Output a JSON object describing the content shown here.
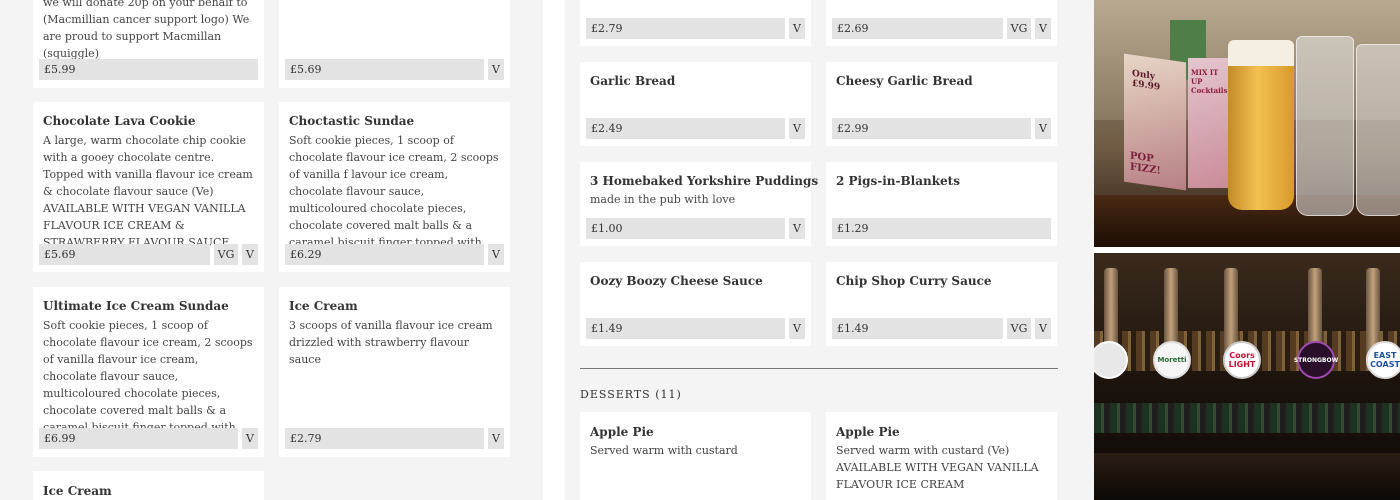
{
  "left_cards": [
    {
      "title": "",
      "desc": "we will donate 20p on your behalf to (Macmillian cancer support logo) We are proud to support Macmillan (squiggle)",
      "price": "£5.99",
      "tags": []
    },
    {
      "title": "",
      "desc": "",
      "price": "£5.69",
      "tags": [
        "V"
      ]
    },
    {
      "title": "Chocolate Lava Cookie",
      "desc": "A large, warm chocolate chip cookie with a gooey chocolate centre. Topped with vanilla flavour ice cream & chocolate flavour sauce (Ve) AVAILABLE WITH VEGAN VANILLA FLAVOUR ICE CREAM & STRAWBERRY FLAVOUR SAUCE",
      "price": "£5.69",
      "tags": [
        "VG",
        "V"
      ]
    },
    {
      "title": "Choctastic Sundae",
      "desc": "Soft cookie pieces, 1 scoop of chocolate flavour ice cream, 2 scoops of vanilla f lavour ice cream, chocolate flavour sauce, multicoloured chocolate pieces, chocolate covered malt balls & a caramel biscuit finger topped with cream",
      "price": "£6.29",
      "tags": [
        "V"
      ]
    },
    {
      "title": "Ultimate Ice Cream Sundae",
      "desc": "Soft cookie pieces, 1 scoop of chocolate flavour ice cream, 2 scoops of vanilla flavour ice cream, chocolate flavour sauce, multicoloured chocolate pieces, chocolate covered malt balls & a caramel biscuit finger topped with cream",
      "price": "£6.99",
      "tags": [
        "V"
      ]
    },
    {
      "title": "Ice Cream",
      "desc": "3 scoops of vanilla flavour ice cream drizzled with strawberry flavour sauce",
      "price": "£2.79",
      "tags": [
        "V"
      ]
    },
    {
      "title": "Ice Cream",
      "desc": "",
      "price": "",
      "tags": []
    }
  ],
  "mid_cards": [
    {
      "title": "",
      "desc": "",
      "price": "£2.79",
      "tags": [
        "V"
      ]
    },
    {
      "title": "",
      "desc": "",
      "price": "£2.69",
      "tags": [
        "VG",
        "V"
      ]
    },
    {
      "title": "Garlic Bread",
      "desc": "",
      "price": "£2.49",
      "tags": [
        "V"
      ]
    },
    {
      "title": "Cheesy Garlic Bread",
      "desc": "",
      "price": "£2.99",
      "tags": [
        "V"
      ]
    },
    {
      "title": "3 Homebaked Yorkshire Puddings",
      "desc": "made in the pub with love",
      "price": "£1.00",
      "tags": [
        "V"
      ]
    },
    {
      "title": "2 Pigs-in-Blankets",
      "desc": "",
      "price": "£1.29",
      "tags": []
    },
    {
      "title": "Oozy Boozy Cheese Sauce",
      "desc": "",
      "price": "£1.49",
      "tags": [
        "V"
      ]
    },
    {
      "title": "Chip Shop Curry Sauce",
      "desc": "",
      "price": "£1.49",
      "tags": [
        "VG",
        "V"
      ]
    }
  ],
  "desserts_heading": "DESSERTS (11)",
  "dessert_cards": [
    {
      "title": "Apple Pie",
      "desc": "Served warm with custard"
    },
    {
      "title": "Apple Pie",
      "desc": "Served warm with custard (Ve) AVAILABLE WITH VEGAN VANILLA FLAVOUR ICE CREAM"
    }
  ],
  "photos": {
    "top_alt": "beer glasses on table",
    "bottom_alt": "bar taps",
    "poster_text": "POP FIZZ!",
    "poster_price": "Only £9.99",
    "poster2_text": "MIX IT UP Cocktails",
    "tap_badges": [
      "",
      "Moretti",
      "Coors LIGHT",
      "STRONGBOW",
      "EAST COAST"
    ],
    "colors": {
      "accent": "#e3e3e3",
      "card": "#ffffff",
      "page": "#f4f4f4"
    }
  }
}
